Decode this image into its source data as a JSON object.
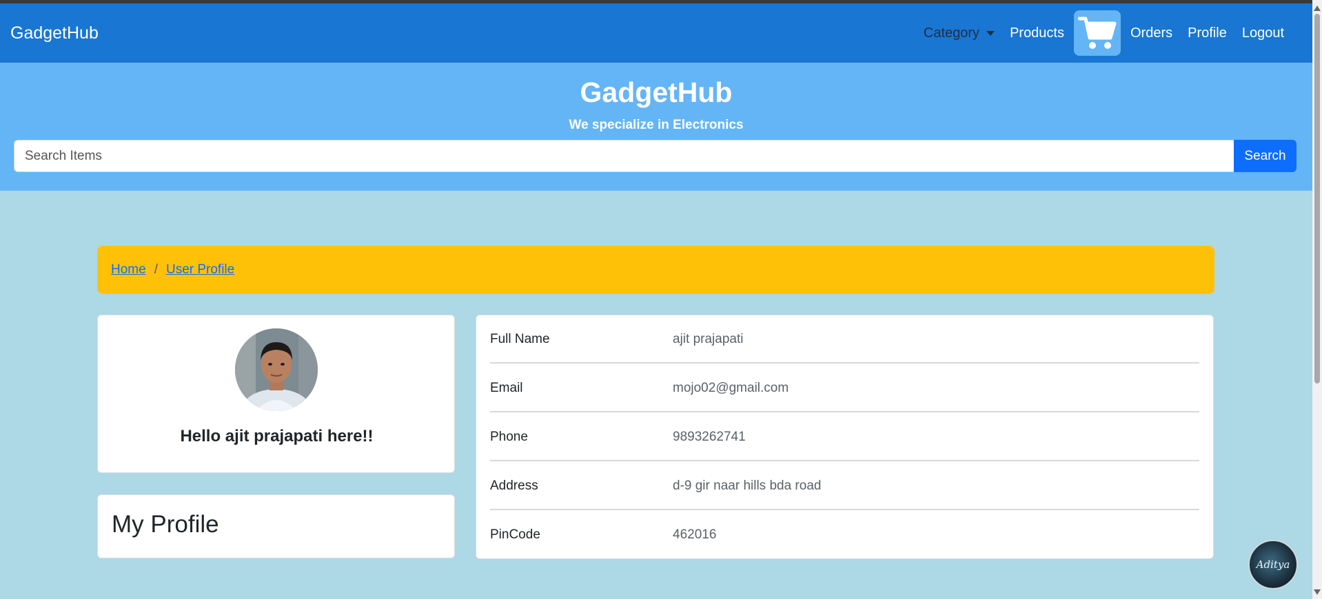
{
  "nav": {
    "brand": "GadgetHub",
    "category_label": "Category",
    "products_label": "Products",
    "cart_icon": "shopping-cart-icon",
    "orders_label": "Orders",
    "profile_label": "Profile",
    "logout_label": "Logout"
  },
  "hero": {
    "title": "GadgetHub",
    "subtitle": "We specialize in Electronics",
    "search_placeholder": "Search Items",
    "search_button": "Search"
  },
  "breadcrumb": {
    "items": [
      "Home",
      "User Profile"
    ],
    "separator": "/"
  },
  "user_card": {
    "greeting": "Hello ajit prajapati here!!"
  },
  "profile_heading": "My Profile",
  "details": [
    {
      "label": "Full Name",
      "value": "ajit prajapati"
    },
    {
      "label": "Email",
      "value": "mojo02@gmail.com"
    },
    {
      "label": "Phone",
      "value": "9893262741"
    },
    {
      "label": "Address",
      "value": "d-9 gir naar hills bda road"
    },
    {
      "label": "PinCode",
      "value": "462016"
    }
  ],
  "badge": {
    "text": "Aditya"
  },
  "colors": {
    "navbar": "#1976d2",
    "hero": "#64b5f6",
    "page_bg": "#add8e6",
    "breadcrumb_bg": "#ffc107",
    "search_button": "#0d6efd"
  }
}
